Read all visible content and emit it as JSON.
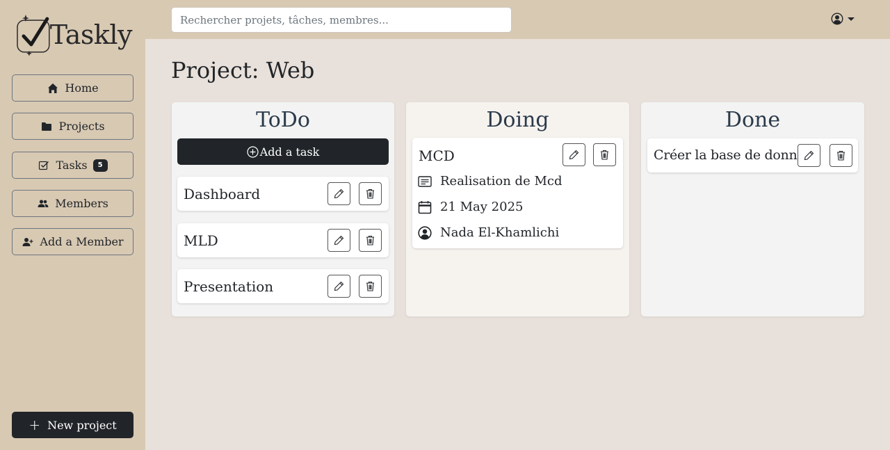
{
  "app": {
    "name": "Taskly"
  },
  "sidebar": {
    "items": [
      {
        "label": "Home",
        "icon": "home-icon"
      },
      {
        "label": "Projects",
        "icon": "folder-icon"
      },
      {
        "label": "Tasks",
        "icon": "check-square-icon",
        "badge": "5"
      },
      {
        "label": "Members",
        "icon": "people-icon"
      },
      {
        "label": "Add a Member",
        "icon": "person-plus-icon"
      }
    ],
    "new_project_label": "New project",
    "new_project_icon": "+"
  },
  "topbar": {
    "search_placeholder": "Rechercher projets, tâches, membres...",
    "user_icon": "user-circle-icon"
  },
  "page": {
    "title": "Project: Web"
  },
  "board": {
    "columns": [
      {
        "title": "ToDo",
        "add_task_label": "Add a task",
        "cards": [
          {
            "title": "Dashboard"
          },
          {
            "title": "MLD"
          },
          {
            "title": "Presentation"
          }
        ]
      },
      {
        "title": "Doing",
        "cards": [
          {
            "title": "MCD",
            "description": "Realisation de Mcd",
            "date": "21 May 2025",
            "assignee": "Nada El-Khamlichi"
          }
        ]
      },
      {
        "title": "Done",
        "cards": [
          {
            "title": "Créer la base de données"
          }
        ]
      }
    ]
  },
  "colors": {
    "sidebar_bg": "#d8c9b3",
    "content_bg": "#e8e0da",
    "dark_button": "#212529",
    "column_title": "#2b3a4a"
  }
}
